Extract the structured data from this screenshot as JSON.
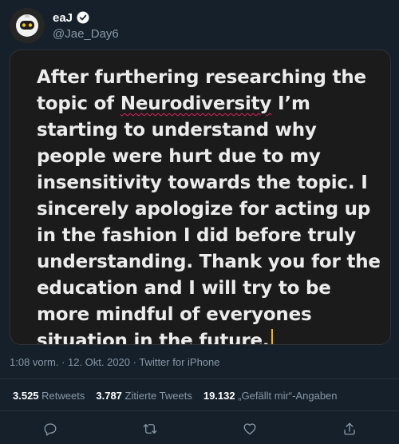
{
  "author": {
    "display_name": "eaJ",
    "handle": "@Jae_Day6",
    "verified_icon": "verified-badge-icon"
  },
  "image": {
    "lines": [
      "After furthering researching the",
      "topic of",
      "Neurodiversity",
      "I’m",
      "starting to understand why",
      "people were hurt due to my",
      "insensitivity towards the topic. I",
      "sincerely apologize for acting up",
      "in the fashion I did before truly",
      "understanding. Thank you for the",
      "education and I will try to be",
      "more mindful of everyones",
      "situation in the future."
    ]
  },
  "meta": "1:08 vorm. · 12. Okt. 2020 · Twitter for iPhone",
  "stats": {
    "retweets_count": "3.525",
    "retweets_label": "Retweets",
    "quotes_count": "3.787",
    "quotes_label": "Zitierte Tweets",
    "likes_count": "19.132",
    "likes_label": "„Gefällt mir“-Angaben"
  },
  "actions": [
    "reply-icon",
    "retweet-icon",
    "like-icon",
    "share-icon"
  ],
  "colors": {
    "background": "#15202b",
    "secondary_text": "#8899a6",
    "spell_underline": "#e0245e",
    "cursor": "#f5b800"
  }
}
